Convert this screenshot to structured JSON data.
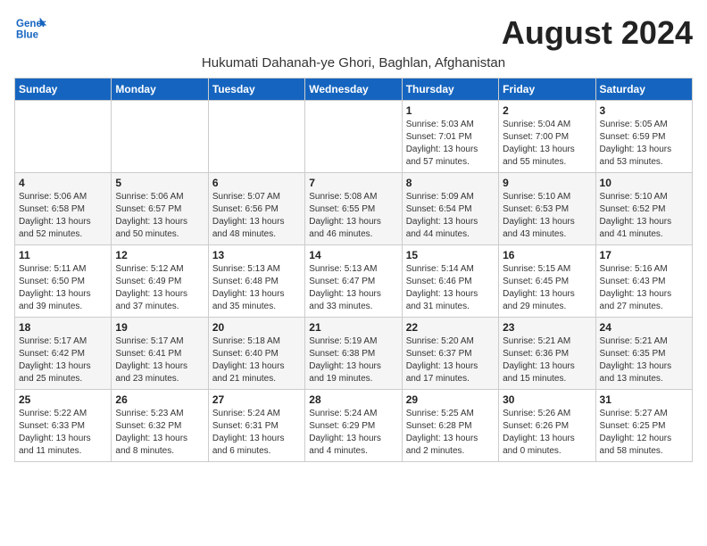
{
  "header": {
    "logo_line1": "General",
    "logo_line2": "Blue",
    "month_year": "August 2024",
    "subtitle": "Hukumati Dahanah-ye Ghori, Baghlan, Afghanistan"
  },
  "weekdays": [
    "Sunday",
    "Monday",
    "Tuesday",
    "Wednesday",
    "Thursday",
    "Friday",
    "Saturday"
  ],
  "weeks": [
    [
      {
        "day": "",
        "info": ""
      },
      {
        "day": "",
        "info": ""
      },
      {
        "day": "",
        "info": ""
      },
      {
        "day": "",
        "info": ""
      },
      {
        "day": "1",
        "info": "Sunrise: 5:03 AM\nSunset: 7:01 PM\nDaylight: 13 hours\nand 57 minutes."
      },
      {
        "day": "2",
        "info": "Sunrise: 5:04 AM\nSunset: 7:00 PM\nDaylight: 13 hours\nand 55 minutes."
      },
      {
        "day": "3",
        "info": "Sunrise: 5:05 AM\nSunset: 6:59 PM\nDaylight: 13 hours\nand 53 minutes."
      }
    ],
    [
      {
        "day": "4",
        "info": "Sunrise: 5:06 AM\nSunset: 6:58 PM\nDaylight: 13 hours\nand 52 minutes."
      },
      {
        "day": "5",
        "info": "Sunrise: 5:06 AM\nSunset: 6:57 PM\nDaylight: 13 hours\nand 50 minutes."
      },
      {
        "day": "6",
        "info": "Sunrise: 5:07 AM\nSunset: 6:56 PM\nDaylight: 13 hours\nand 48 minutes."
      },
      {
        "day": "7",
        "info": "Sunrise: 5:08 AM\nSunset: 6:55 PM\nDaylight: 13 hours\nand 46 minutes."
      },
      {
        "day": "8",
        "info": "Sunrise: 5:09 AM\nSunset: 6:54 PM\nDaylight: 13 hours\nand 44 minutes."
      },
      {
        "day": "9",
        "info": "Sunrise: 5:10 AM\nSunset: 6:53 PM\nDaylight: 13 hours\nand 43 minutes."
      },
      {
        "day": "10",
        "info": "Sunrise: 5:10 AM\nSunset: 6:52 PM\nDaylight: 13 hours\nand 41 minutes."
      }
    ],
    [
      {
        "day": "11",
        "info": "Sunrise: 5:11 AM\nSunset: 6:50 PM\nDaylight: 13 hours\nand 39 minutes."
      },
      {
        "day": "12",
        "info": "Sunrise: 5:12 AM\nSunset: 6:49 PM\nDaylight: 13 hours\nand 37 minutes."
      },
      {
        "day": "13",
        "info": "Sunrise: 5:13 AM\nSunset: 6:48 PM\nDaylight: 13 hours\nand 35 minutes."
      },
      {
        "day": "14",
        "info": "Sunrise: 5:13 AM\nSunset: 6:47 PM\nDaylight: 13 hours\nand 33 minutes."
      },
      {
        "day": "15",
        "info": "Sunrise: 5:14 AM\nSunset: 6:46 PM\nDaylight: 13 hours\nand 31 minutes."
      },
      {
        "day": "16",
        "info": "Sunrise: 5:15 AM\nSunset: 6:45 PM\nDaylight: 13 hours\nand 29 minutes."
      },
      {
        "day": "17",
        "info": "Sunrise: 5:16 AM\nSunset: 6:43 PM\nDaylight: 13 hours\nand 27 minutes."
      }
    ],
    [
      {
        "day": "18",
        "info": "Sunrise: 5:17 AM\nSunset: 6:42 PM\nDaylight: 13 hours\nand 25 minutes."
      },
      {
        "day": "19",
        "info": "Sunrise: 5:17 AM\nSunset: 6:41 PM\nDaylight: 13 hours\nand 23 minutes."
      },
      {
        "day": "20",
        "info": "Sunrise: 5:18 AM\nSunset: 6:40 PM\nDaylight: 13 hours\nand 21 minutes."
      },
      {
        "day": "21",
        "info": "Sunrise: 5:19 AM\nSunset: 6:38 PM\nDaylight: 13 hours\nand 19 minutes."
      },
      {
        "day": "22",
        "info": "Sunrise: 5:20 AM\nSunset: 6:37 PM\nDaylight: 13 hours\nand 17 minutes."
      },
      {
        "day": "23",
        "info": "Sunrise: 5:21 AM\nSunset: 6:36 PM\nDaylight: 13 hours\nand 15 minutes."
      },
      {
        "day": "24",
        "info": "Sunrise: 5:21 AM\nSunset: 6:35 PM\nDaylight: 13 hours\nand 13 minutes."
      }
    ],
    [
      {
        "day": "25",
        "info": "Sunrise: 5:22 AM\nSunset: 6:33 PM\nDaylight: 13 hours\nand 11 minutes."
      },
      {
        "day": "26",
        "info": "Sunrise: 5:23 AM\nSunset: 6:32 PM\nDaylight: 13 hours\nand 8 minutes."
      },
      {
        "day": "27",
        "info": "Sunrise: 5:24 AM\nSunset: 6:31 PM\nDaylight: 13 hours\nand 6 minutes."
      },
      {
        "day": "28",
        "info": "Sunrise: 5:24 AM\nSunset: 6:29 PM\nDaylight: 13 hours\nand 4 minutes."
      },
      {
        "day": "29",
        "info": "Sunrise: 5:25 AM\nSunset: 6:28 PM\nDaylight: 13 hours\nand 2 minutes."
      },
      {
        "day": "30",
        "info": "Sunrise: 5:26 AM\nSunset: 6:26 PM\nDaylight: 13 hours\nand 0 minutes."
      },
      {
        "day": "31",
        "info": "Sunrise: 5:27 AM\nSunset: 6:25 PM\nDaylight: 12 hours\nand 58 minutes."
      }
    ]
  ]
}
